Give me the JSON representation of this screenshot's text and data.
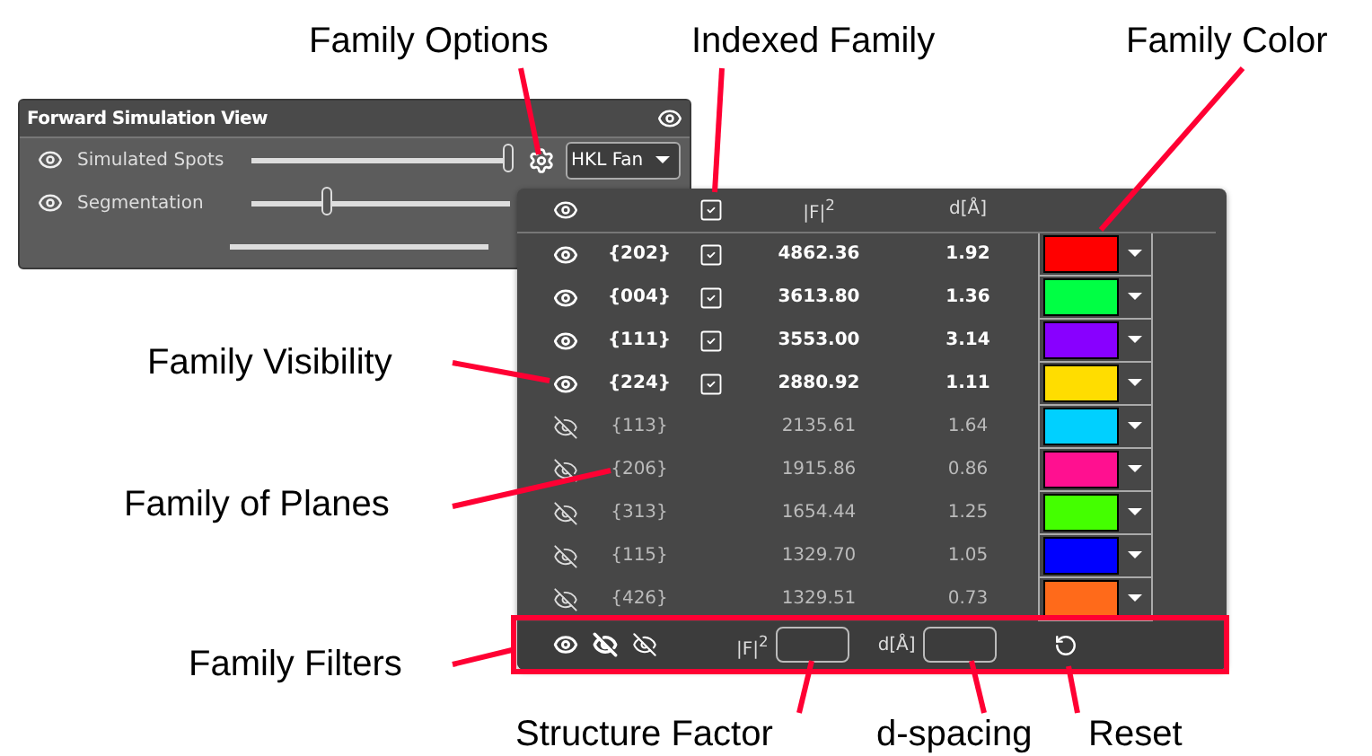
{
  "callouts": [
    {
      "text": "Family Options"
    },
    {
      "text": "Indexed Family"
    },
    {
      "text": "Family Color"
    },
    {
      "text": "Family Visibility"
    },
    {
      "text": "Family of Planes"
    },
    {
      "text": "Family Filters"
    },
    {
      "text": "Structure Factor"
    },
    {
      "text": "d-spacing"
    },
    {
      "text": "Reset"
    }
  ],
  "view_panel": {
    "title": "Forward Simulation View",
    "rows": [
      {
        "label": "Simulated Spots",
        "visible": true,
        "level": 1.0
      },
      {
        "label": "Segmentation",
        "visible": true,
        "level": 0.3
      }
    ],
    "family_dropdown": "HKL Fan"
  },
  "family_table": {
    "columns": [
      "|F|$^{2}$",
      "d[Å]"
    ],
    "families": [
      {
        "name": "{202}",
        "visible": true,
        "indexed": true,
        "f2": "4862.36",
        "d": "1.92",
        "color": "#ff0000"
      },
      {
        "name": "{004}",
        "visible": true,
        "indexed": true,
        "f2": "3613.80",
        "d": "1.36",
        "color": "#00ff44"
      },
      {
        "name": "{111}",
        "visible": true,
        "indexed": true,
        "f2": "3553.00",
        "d": "3.14",
        "color": "#8800ff"
      },
      {
        "name": "{224}",
        "visible": true,
        "indexed": true,
        "f2": "2880.92",
        "d": "1.11",
        "color": "#ffdd00"
      },
      {
        "name": "{113}",
        "visible": false,
        "indexed": false,
        "f2": "2135.61",
        "d": "1.64",
        "color": "#00d0ff"
      },
      {
        "name": "{206}",
        "visible": false,
        "indexed": false,
        "f2": "1915.86",
        "d": "0.86",
        "color": "#ff1090"
      },
      {
        "name": "{313}",
        "visible": false,
        "indexed": false,
        "f2": "1654.44",
        "d": "1.25",
        "color": "#44ff00"
      },
      {
        "name": "{115}",
        "visible": false,
        "indexed": false,
        "f2": "1329.70",
        "d": "1.05",
        "color": "#0000ff"
      },
      {
        "name": "{426}",
        "visible": false,
        "indexed": false,
        "f2": "1329.51",
        "d": "0.73",
        "color": "#ff6a1a"
      }
    ],
    "filters": {
      "f2_label": "|F|$^{2}$",
      "d_label": "d[Å]"
    }
  }
}
